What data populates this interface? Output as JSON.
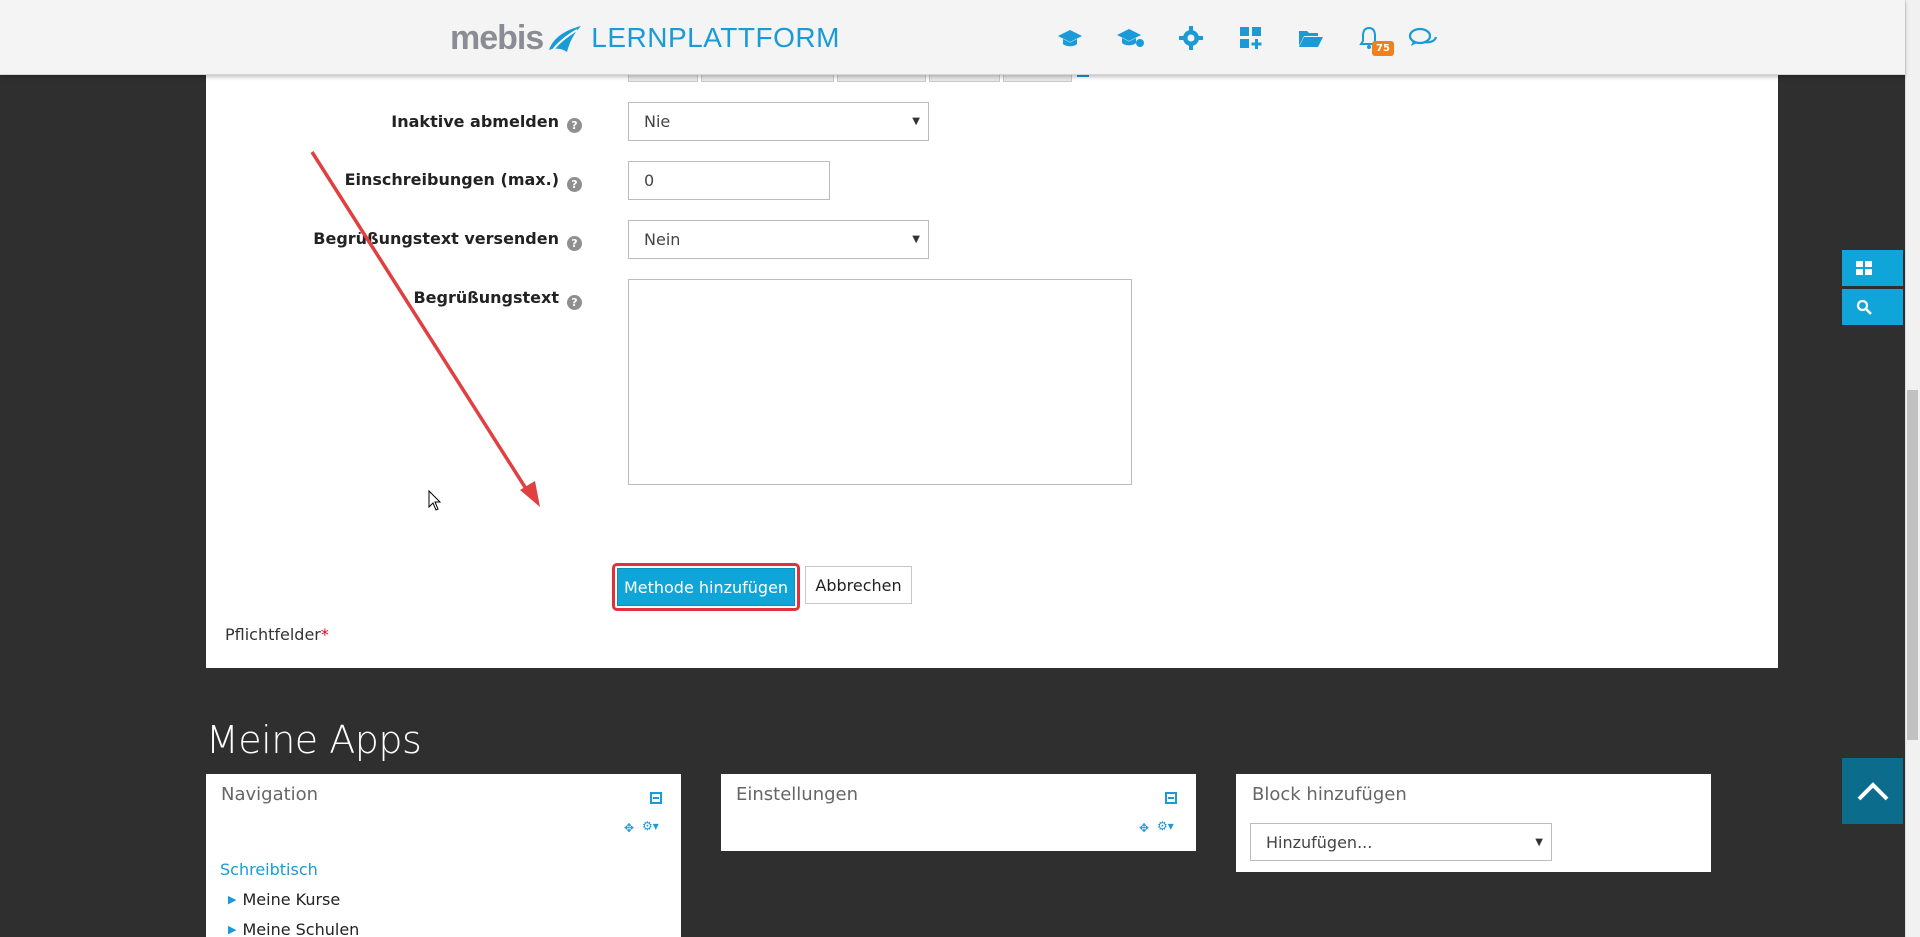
{
  "header": {
    "logo_brand": "mebis",
    "logo_product": "LERNPLATTFORM",
    "nav_icons": [
      "courses-icon",
      "teacher-icon",
      "gear-icon",
      "apps-add-icon",
      "folder-icon",
      "bell-icon",
      "chat-icon"
    ],
    "notification_count": "75"
  },
  "form": {
    "fields": [
      {
        "label": "Inaktive abmelden",
        "type": "select",
        "value": "Nie"
      },
      {
        "label": "Einschreibungen (max.)",
        "type": "text",
        "value": "0"
      },
      {
        "label": "Begrüßungstext versenden",
        "type": "select",
        "value": "Nein"
      },
      {
        "label": "Begrüßungstext",
        "type": "textarea",
        "value": ""
      }
    ],
    "submit_label": "Methode hinzufügen",
    "cancel_label": "Abbrechen",
    "required_label": "Pflichtfelder",
    "required_marker": "*"
  },
  "apps": {
    "title": "Meine Apps",
    "navigation": {
      "title": "Navigation",
      "home_link": "Schreibtisch",
      "items": [
        "Meine Kurse",
        "Meine Schulen"
      ]
    },
    "settings": {
      "title": "Einstellungen"
    },
    "add_block": {
      "title": "Block hinzufügen",
      "select_value": "Hinzufügen..."
    }
  },
  "colors": {
    "accent": "#0fa5d9",
    "highlight": "#e0323b",
    "badge": "#f0801b"
  }
}
